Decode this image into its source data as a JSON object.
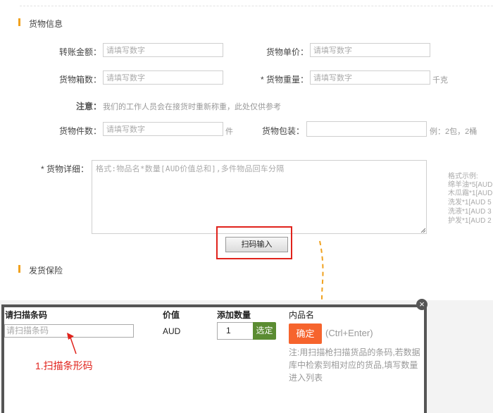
{
  "goods_section": {
    "title": "货物信息",
    "transfer_amount": {
      "label": "转账金额：",
      "placeholder": "请填写数字"
    },
    "unit_price": {
      "label": "货物单价：",
      "placeholder": "请填写数字"
    },
    "box_count": {
      "label": "货物箱数：",
      "placeholder": "请填写数字"
    },
    "weight": {
      "label": "* 货物重量：",
      "placeholder": "请填写数字",
      "unit": "千克"
    },
    "notice": {
      "label": "注意：",
      "text": "我们的工作人员会在接货时重新称重，此处仅供参考"
    },
    "piece_count": {
      "label": "货物件数：",
      "placeholder": "请填写数字",
      "unit": "件"
    },
    "packaging": {
      "label": "货物包装：",
      "placeholder": "",
      "example": "例：2包，2桶"
    },
    "details": {
      "label": "* 货物详细：",
      "placeholder": "格式:物品名*数量[AUD价值总和],多件物品回车分隔"
    },
    "example": {
      "title": "格式示例:",
      "lines": [
        "绵羊油*5[AUD",
        "木瓜霜*1[AUD",
        "洗发*1[AUD 5",
        "洗液*1[AUD 3",
        "护发*1[AUD 2"
      ]
    },
    "scan_button": "扫码输入"
  },
  "insurance_section": {
    "title": "发货保险"
  },
  "scan_dialog": {
    "col_barcode": "请扫描条码",
    "col_value": "价值",
    "col_qty": "添加数量",
    "col_name": "内品名",
    "barcode_placeholder": "请扫描条码",
    "currency": "AUD",
    "qty_value": "1",
    "qty_button": "选定",
    "ok_button": "确定",
    "shortcut": "(Ctrl+Enter)",
    "note": "注:用扫描枪扫描货品的条码,若数据库中检索到相对应的货品,填写数量进入列表",
    "close": "×"
  },
  "annotation": {
    "step1": "1.扫描条形码"
  },
  "colors": {
    "accent": "#f0a11e",
    "highlight": "#e0231c",
    "ok": "#f6642d",
    "select": "#5b8c32",
    "arrow": "#f0a11e"
  }
}
